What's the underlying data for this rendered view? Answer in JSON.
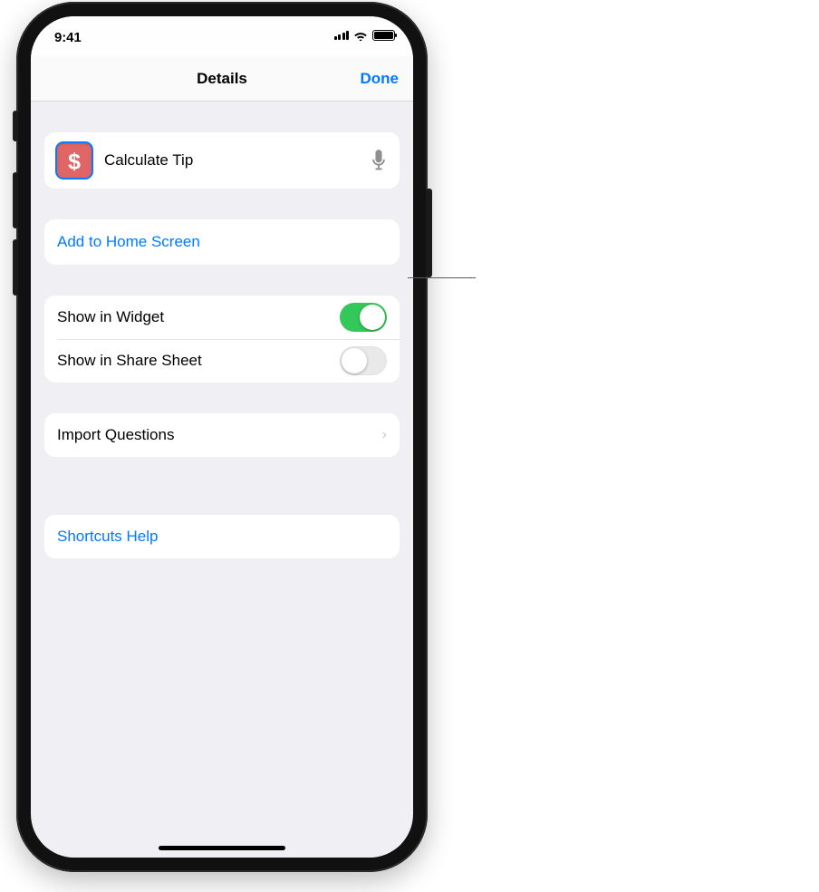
{
  "statusbar": {
    "time": "9:41"
  },
  "nav": {
    "title": "Details",
    "done": "Done"
  },
  "shortcut": {
    "name": "Calculate Tip",
    "icon": "dollar-icon"
  },
  "actions": {
    "add_home": "Add to Home Screen",
    "import_questions": "Import Questions",
    "help": "Shortcuts Help"
  },
  "toggles": {
    "widget": {
      "label": "Show in Widget",
      "on": true
    },
    "share": {
      "label": "Show in Share Sheet",
      "on": false
    }
  }
}
